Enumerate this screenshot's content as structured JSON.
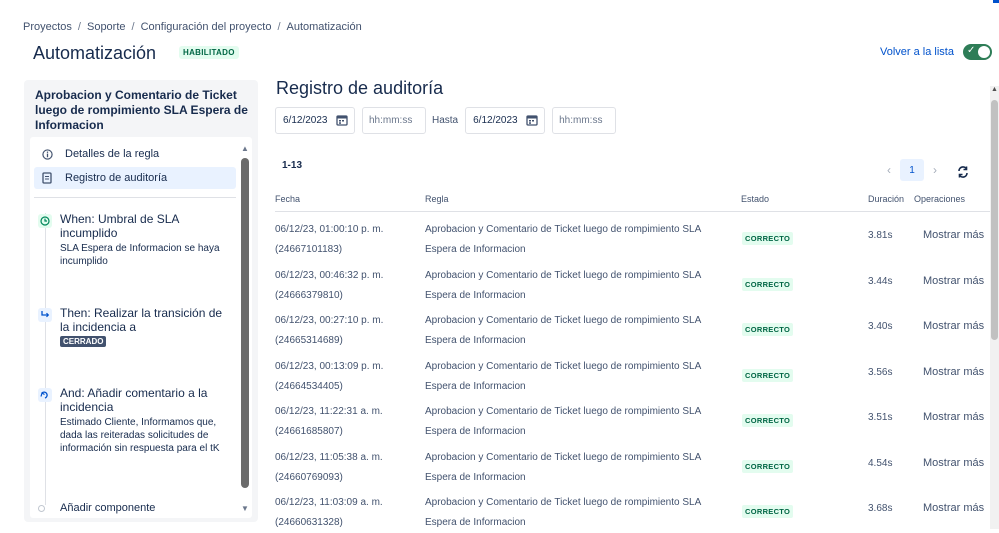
{
  "breadcrumb": [
    "Proyectos",
    "Soporte",
    "Configuración del proyecto",
    "Automatización"
  ],
  "page_title": "Automatización",
  "status_badge": "HABILITADO",
  "back_link": "Volver a la lista",
  "rule": {
    "title": "Aprobacion y Comentario de Ticket luego de rompimiento SLA Espera de Informacion"
  },
  "nav": {
    "details": "Detalles de la regla",
    "audit": "Registro de auditoría"
  },
  "steps": {
    "when_title": "When: Umbral de SLA incumplido",
    "when_desc": "SLA Espera de Informacion se haya incumplido",
    "then_title": "Then: Realizar la transición de la incidencia a",
    "then_badge": "CERRADO",
    "and_title": "And: Añadir comentario a la incidencia",
    "and_desc": "Estimado Cliente, Informamos que, dada las reiteradas solicitudes de información sin respuesta para el tK",
    "add_component": "Añadir componente"
  },
  "audit": {
    "title": "Registro de auditoría",
    "from_date": "6/12/2023",
    "from_time_placeholder": "hh:mm:ss",
    "until_label": "Hasta",
    "to_date": "6/12/2023",
    "to_time_placeholder": "hh:mm:ss",
    "range": "1-13",
    "page": "1",
    "columns": {
      "fecha": "Fecha",
      "regla": "Regla",
      "estado": "Estado",
      "duracion": "Duración",
      "operaciones": "Operaciones"
    },
    "rows": [
      {
        "date": "06/12/23, 01:00:10 p. m.",
        "id": "(24667101183)",
        "rule1": "Aprobacion y Comentario de Ticket luego de rompimiento SLA",
        "rule2": "Espera de Informacion",
        "status": "CORRECTO",
        "duration": "3.81s",
        "action": "Mostrar más"
      },
      {
        "date": "06/12/23, 00:46:32 p. m.",
        "id": "(24666379810)",
        "rule1": "Aprobacion y Comentario de Ticket luego de rompimiento SLA",
        "rule2": "Espera de Informacion",
        "status": "CORRECTO",
        "duration": "3.44s",
        "action": "Mostrar más"
      },
      {
        "date": "06/12/23, 00:27:10 p. m.",
        "id": "(24665314689)",
        "rule1": "Aprobacion y Comentario de Ticket luego de rompimiento SLA",
        "rule2": "Espera de Informacion",
        "status": "CORRECTO",
        "duration": "3.40s",
        "action": "Mostrar más"
      },
      {
        "date": "06/12/23, 00:13:09 p. m.",
        "id": "(24664534405)",
        "rule1": "Aprobacion y Comentario de Ticket luego de rompimiento SLA",
        "rule2": "Espera de Informacion",
        "status": "CORRECTO",
        "duration": "3.56s",
        "action": "Mostrar más"
      },
      {
        "date": "06/12/23, 11:22:31 a. m.",
        "id": "(24661685807)",
        "rule1": "Aprobacion y Comentario de Ticket luego de rompimiento SLA",
        "rule2": "Espera de Informacion",
        "status": "CORRECTO",
        "duration": "3.51s",
        "action": "Mostrar más"
      },
      {
        "date": "06/12/23, 11:05:38 a. m.",
        "id": "(24660769093)",
        "rule1": "Aprobacion y Comentario de Ticket luego de rompimiento SLA",
        "rule2": "Espera de Informacion",
        "status": "CORRECTO",
        "duration": "4.54s",
        "action": "Mostrar más"
      },
      {
        "date": "06/12/23, 11:03:09 a. m.",
        "id": "(24660631328)",
        "rule1": "Aprobacion y Comentario de Ticket luego de rompimiento SLA",
        "rule2": "Espera de Informacion",
        "status": "CORRECTO",
        "duration": "3.68s",
        "action": "Mostrar más"
      }
    ]
  },
  "colors": {
    "accent": "#0052cc",
    "success_bg": "#e3fcef",
    "success_text": "#006644",
    "toggle_on": "#2e7d57"
  }
}
